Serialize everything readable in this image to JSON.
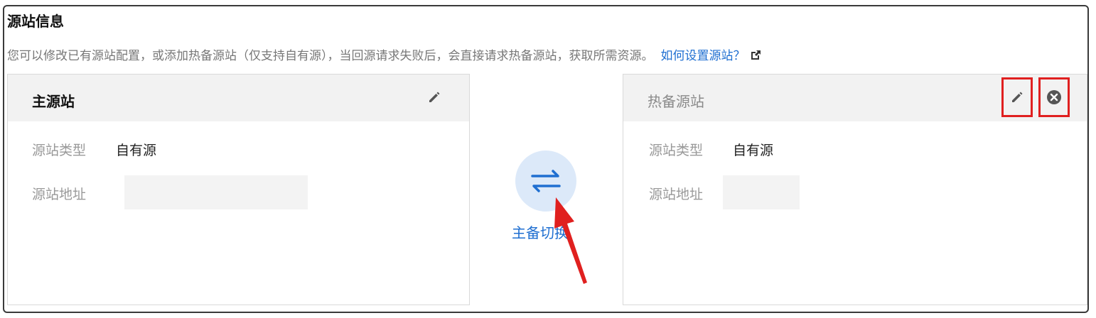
{
  "section": {
    "title": "源站信息",
    "description": "您可以修改已有源站配置，或添加热备源站（仅支持自有源），当回源请求失败后，会直接请求热备源站，获取所需资源。",
    "help_link": "如何设置源站？"
  },
  "primary": {
    "title": "主源站",
    "type_label": "源站类型",
    "type_value": "自有源",
    "address_label": "源站地址",
    "address_value": ""
  },
  "backup": {
    "title": "热备源站",
    "type_label": "源站类型",
    "type_value": "自有源",
    "address_label": "源站地址",
    "address_value": ""
  },
  "switch": {
    "label": "主备切换",
    "icon": "swap-arrows-icon"
  },
  "colors": {
    "link": "#1f6fd1",
    "highlight": "#e02020",
    "header_bg": "#f2f2f2",
    "switch_bg": "#dce9f9"
  }
}
